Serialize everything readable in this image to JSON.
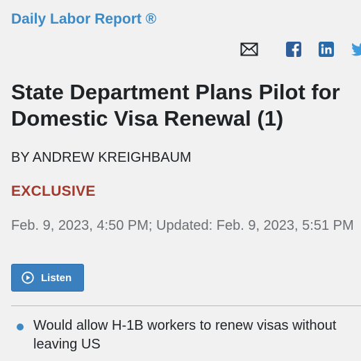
{
  "section": {
    "name": "Daily Labor Report ®"
  },
  "share": {
    "icons": [
      "email-icon",
      "facebook-icon",
      "linkedin-icon",
      "twitter-icon"
    ],
    "colors": {
      "email": "#1f2326",
      "facebook": "#2f5e99",
      "linkedin": "#2a6aa8",
      "twitter": "#3d9be0"
    }
  },
  "article": {
    "headline_line1": "State Department Plans Pilot for",
    "headline_line2": "Domestic Visa Renewal (1)",
    "byline": "BY ANDREW KREIGHBAUM",
    "label": "EXCLUSIVE",
    "dateline": "Feb. 9, 2023, 4:50 PM; Updated: Feb. 9, 2023, 5:51 PM",
    "listen_label": "Listen",
    "bullets": [
      "Would allow H-1B workers to renew visas without leaving US"
    ]
  },
  "colors": {
    "accent": "#3d8ac4",
    "exclusive": "#a23a2e",
    "button": "#3a7fbe",
    "background": "#f1f1f1"
  }
}
